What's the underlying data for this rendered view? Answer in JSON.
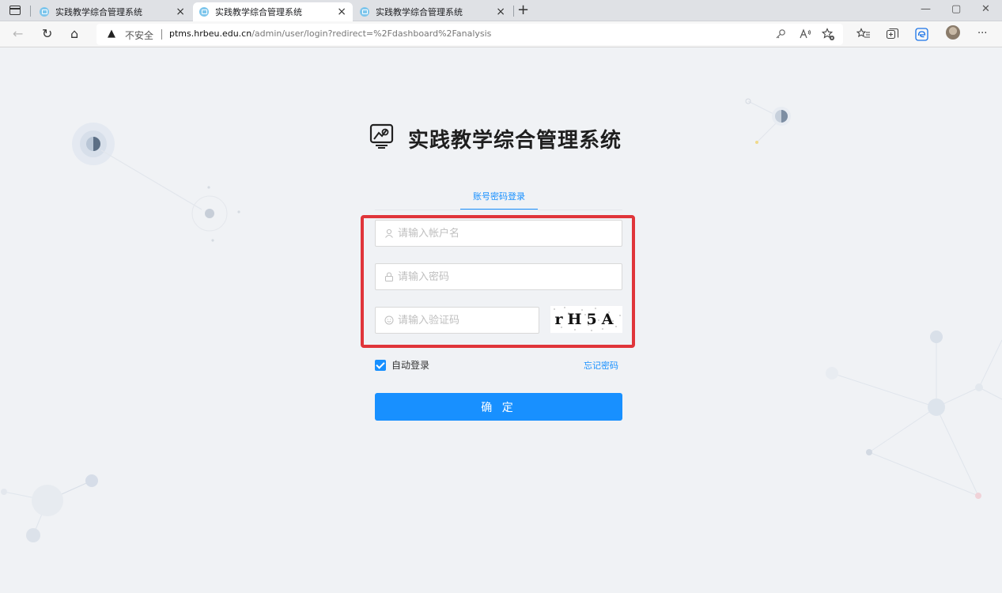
{
  "browser": {
    "tabs": [
      {
        "title": "实践教学综合管理系统",
        "active": false
      },
      {
        "title": "实践教学综合管理系统",
        "active": true
      },
      {
        "title": "实践教学综合管理系统",
        "active": false
      }
    ],
    "close_glyph": "×",
    "new_tab_glyph": "+",
    "window_controls": {
      "minimize": "—",
      "restore": "▢",
      "close": "✕"
    },
    "nav": {
      "back": "←",
      "reload": "↻",
      "home": "⌂"
    },
    "security_label": "不安全",
    "security_icon": "▲",
    "url_host": "ptms.hrbeu.edu.cn",
    "url_path": "/admin/user/login?redirect=%2Fdashboard%2Fanalysis",
    "toolbar_icons": [
      "key-icon",
      "read-aloud-icon",
      "add-favorite-icon",
      "favorites-icon",
      "collections-icon",
      "edge-icon",
      "profile-avatar",
      "more-icon"
    ],
    "more_glyph": "···"
  },
  "login": {
    "app_title": "实践教学综合管理系统",
    "tab_label": "账号密码登录",
    "username_placeholder": "请输入帐户名",
    "password_placeholder": "请输入密码",
    "captcha_placeholder": "请输入验证码",
    "captcha_code": "rH5A",
    "remember_label": "自动登录",
    "remember_checked": true,
    "forgot_label": "忘记密码",
    "submit_label": "确 定"
  },
  "colors": {
    "primary": "#1890ff",
    "highlight": "#e0353a",
    "page_bg": "#f0f2f5"
  }
}
